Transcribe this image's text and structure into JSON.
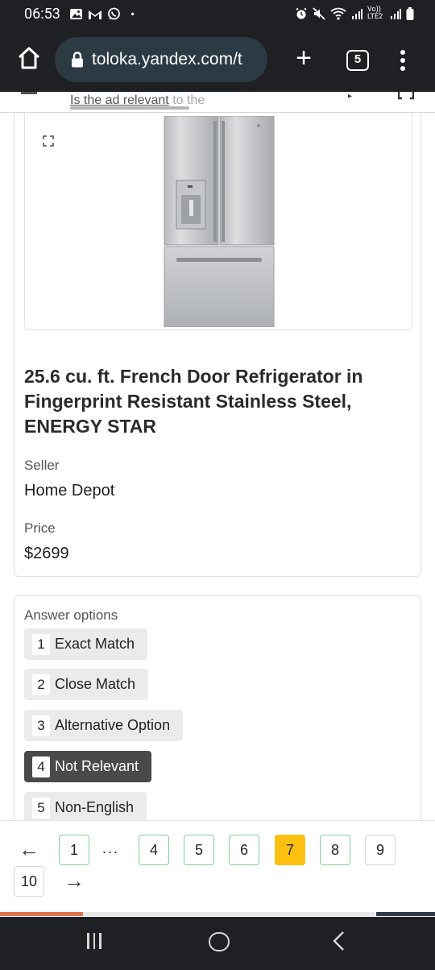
{
  "status_bar": {
    "time": "06:53",
    "dot": "•",
    "network_label": "Vo)) LTE2",
    "left_icons": [
      "gallery-icon",
      "gmail-icon",
      "whatsapp-icon"
    ],
    "right_icons": [
      "alarm-icon",
      "mute-icon",
      "wifi-icon",
      "signal-icon",
      "signal-icon",
      "battery-icon"
    ]
  },
  "browser": {
    "url": "toloka.yandex.com/t",
    "tab_count": "5",
    "plus_label": "+"
  },
  "question": {
    "text_link": "Is the ad relevant",
    "text_tail": " to the"
  },
  "product": {
    "title": "25.6 cu. ft. French Door Refrigerator in Fingerprint Resistant Stainless Steel, ENERGY STAR",
    "seller_label": "Seller",
    "seller_value": "Home Depot",
    "price_label": "Price",
    "price_value": "$2699"
  },
  "answers": {
    "title": "Answer options",
    "options": [
      {
        "key": "1",
        "label": "Exact Match"
      },
      {
        "key": "2",
        "label": "Close Match"
      },
      {
        "key": "3",
        "label": "Alternative Option"
      },
      {
        "key": "4",
        "label": "Not Relevant",
        "selected": true
      },
      {
        "key": "5",
        "label": "Non-English"
      }
    ]
  },
  "pagination": {
    "prev_arrow": "←",
    "next_arrow": "→",
    "ellipsis": "...",
    "pages": [
      "1",
      "4",
      "5",
      "6",
      "7",
      "8",
      "9",
      "10"
    ],
    "current_page": "7"
  },
  "progress": {
    "done_fraction": 0.19,
    "remaining_fraction": 0.67
  },
  "colors": {
    "dark_bar": "#1f2023",
    "url_pill": "#2c3a44",
    "active_page": "#fcc010",
    "done_border": "#7fcf94",
    "selected_answer": "#4a4a4a",
    "progress_done": "#e0734f"
  }
}
